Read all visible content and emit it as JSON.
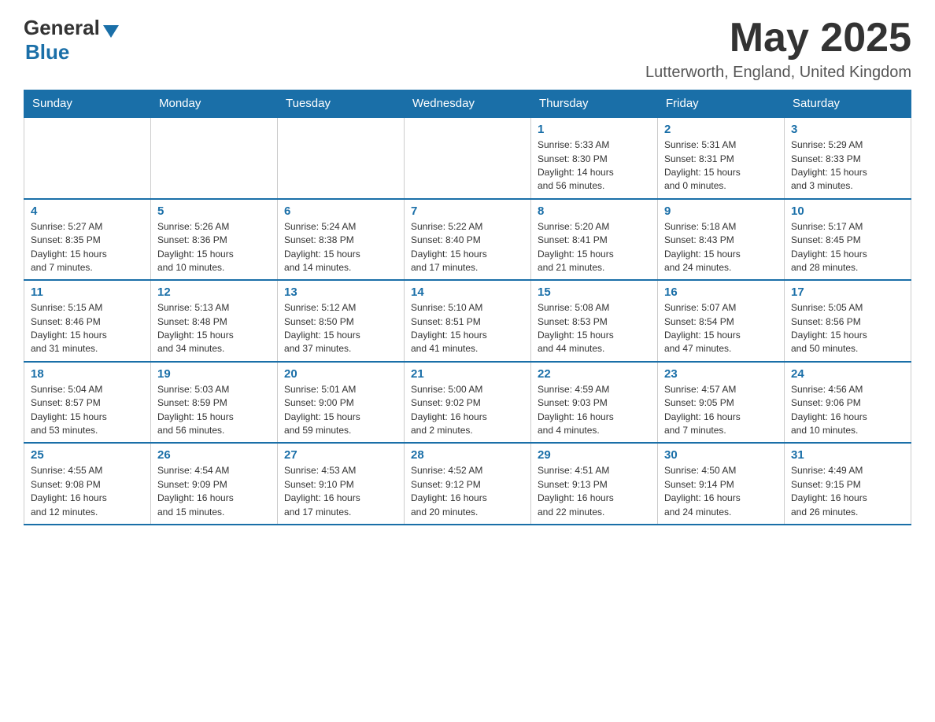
{
  "header": {
    "logo_general": "General",
    "logo_blue": "Blue",
    "month_title": "May 2025",
    "location": "Lutterworth, England, United Kingdom"
  },
  "weekdays": [
    "Sunday",
    "Monday",
    "Tuesday",
    "Wednesday",
    "Thursday",
    "Friday",
    "Saturday"
  ],
  "weeks": [
    [
      {
        "day": "",
        "info": ""
      },
      {
        "day": "",
        "info": ""
      },
      {
        "day": "",
        "info": ""
      },
      {
        "day": "",
        "info": ""
      },
      {
        "day": "1",
        "info": "Sunrise: 5:33 AM\nSunset: 8:30 PM\nDaylight: 14 hours\nand 56 minutes."
      },
      {
        "day": "2",
        "info": "Sunrise: 5:31 AM\nSunset: 8:31 PM\nDaylight: 15 hours\nand 0 minutes."
      },
      {
        "day": "3",
        "info": "Sunrise: 5:29 AM\nSunset: 8:33 PM\nDaylight: 15 hours\nand 3 minutes."
      }
    ],
    [
      {
        "day": "4",
        "info": "Sunrise: 5:27 AM\nSunset: 8:35 PM\nDaylight: 15 hours\nand 7 minutes."
      },
      {
        "day": "5",
        "info": "Sunrise: 5:26 AM\nSunset: 8:36 PM\nDaylight: 15 hours\nand 10 minutes."
      },
      {
        "day": "6",
        "info": "Sunrise: 5:24 AM\nSunset: 8:38 PM\nDaylight: 15 hours\nand 14 minutes."
      },
      {
        "day": "7",
        "info": "Sunrise: 5:22 AM\nSunset: 8:40 PM\nDaylight: 15 hours\nand 17 minutes."
      },
      {
        "day": "8",
        "info": "Sunrise: 5:20 AM\nSunset: 8:41 PM\nDaylight: 15 hours\nand 21 minutes."
      },
      {
        "day": "9",
        "info": "Sunrise: 5:18 AM\nSunset: 8:43 PM\nDaylight: 15 hours\nand 24 minutes."
      },
      {
        "day": "10",
        "info": "Sunrise: 5:17 AM\nSunset: 8:45 PM\nDaylight: 15 hours\nand 28 minutes."
      }
    ],
    [
      {
        "day": "11",
        "info": "Sunrise: 5:15 AM\nSunset: 8:46 PM\nDaylight: 15 hours\nand 31 minutes."
      },
      {
        "day": "12",
        "info": "Sunrise: 5:13 AM\nSunset: 8:48 PM\nDaylight: 15 hours\nand 34 minutes."
      },
      {
        "day": "13",
        "info": "Sunrise: 5:12 AM\nSunset: 8:50 PM\nDaylight: 15 hours\nand 37 minutes."
      },
      {
        "day": "14",
        "info": "Sunrise: 5:10 AM\nSunset: 8:51 PM\nDaylight: 15 hours\nand 41 minutes."
      },
      {
        "day": "15",
        "info": "Sunrise: 5:08 AM\nSunset: 8:53 PM\nDaylight: 15 hours\nand 44 minutes."
      },
      {
        "day": "16",
        "info": "Sunrise: 5:07 AM\nSunset: 8:54 PM\nDaylight: 15 hours\nand 47 minutes."
      },
      {
        "day": "17",
        "info": "Sunrise: 5:05 AM\nSunset: 8:56 PM\nDaylight: 15 hours\nand 50 minutes."
      }
    ],
    [
      {
        "day": "18",
        "info": "Sunrise: 5:04 AM\nSunset: 8:57 PM\nDaylight: 15 hours\nand 53 minutes."
      },
      {
        "day": "19",
        "info": "Sunrise: 5:03 AM\nSunset: 8:59 PM\nDaylight: 15 hours\nand 56 minutes."
      },
      {
        "day": "20",
        "info": "Sunrise: 5:01 AM\nSunset: 9:00 PM\nDaylight: 15 hours\nand 59 minutes."
      },
      {
        "day": "21",
        "info": "Sunrise: 5:00 AM\nSunset: 9:02 PM\nDaylight: 16 hours\nand 2 minutes."
      },
      {
        "day": "22",
        "info": "Sunrise: 4:59 AM\nSunset: 9:03 PM\nDaylight: 16 hours\nand 4 minutes."
      },
      {
        "day": "23",
        "info": "Sunrise: 4:57 AM\nSunset: 9:05 PM\nDaylight: 16 hours\nand 7 minutes."
      },
      {
        "day": "24",
        "info": "Sunrise: 4:56 AM\nSunset: 9:06 PM\nDaylight: 16 hours\nand 10 minutes."
      }
    ],
    [
      {
        "day": "25",
        "info": "Sunrise: 4:55 AM\nSunset: 9:08 PM\nDaylight: 16 hours\nand 12 minutes."
      },
      {
        "day": "26",
        "info": "Sunrise: 4:54 AM\nSunset: 9:09 PM\nDaylight: 16 hours\nand 15 minutes."
      },
      {
        "day": "27",
        "info": "Sunrise: 4:53 AM\nSunset: 9:10 PM\nDaylight: 16 hours\nand 17 minutes."
      },
      {
        "day": "28",
        "info": "Sunrise: 4:52 AM\nSunset: 9:12 PM\nDaylight: 16 hours\nand 20 minutes."
      },
      {
        "day": "29",
        "info": "Sunrise: 4:51 AM\nSunset: 9:13 PM\nDaylight: 16 hours\nand 22 minutes."
      },
      {
        "day": "30",
        "info": "Sunrise: 4:50 AM\nSunset: 9:14 PM\nDaylight: 16 hours\nand 24 minutes."
      },
      {
        "day": "31",
        "info": "Sunrise: 4:49 AM\nSunset: 9:15 PM\nDaylight: 16 hours\nand 26 minutes."
      }
    ]
  ]
}
